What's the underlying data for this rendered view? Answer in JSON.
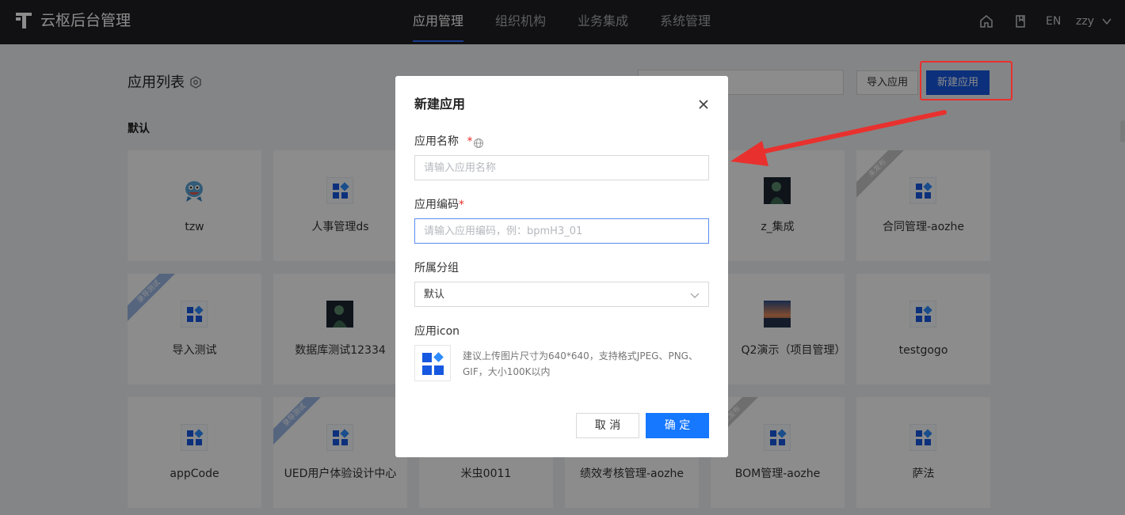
{
  "header": {
    "brand": "云枢后台管理",
    "nav": [
      "应用管理",
      "组织机构",
      "业务集成",
      "系统管理"
    ],
    "active_nav": "应用管理",
    "lang": "EN",
    "user": "zzy"
  },
  "page": {
    "title": "应用列表",
    "group": "默认",
    "import_button": "导入应用",
    "new_button": "新建应用"
  },
  "apps": [
    {
      "name": "tzw",
      "icon": "avatar-fish-icon"
    },
    {
      "name": "人事管理ds",
      "icon": "app-grid-icon"
    },
    {
      "name": "",
      "icon": ""
    },
    {
      "name": "",
      "icon": ""
    },
    {
      "name": "z_集成",
      "icon": "photo-icon"
    },
    {
      "name": "合同管理-aozhe",
      "icon": "app-grid-icon",
      "ribbon": "未发布"
    },
    {
      "name": "导入测试",
      "icon": "app-grid-icon",
      "ribbon": "录导测试"
    },
    {
      "name": "数据库测试12334",
      "icon": "photo-icon"
    },
    {
      "name": "",
      "icon": ""
    },
    {
      "name": "",
      "icon": ""
    },
    {
      "name": "Q2演示（项目管理）",
      "icon": "sunset-photo-icon"
    },
    {
      "name": "testgogo",
      "icon": "app-grid-icon"
    },
    {
      "name": "appCode",
      "icon": "app-grid-icon"
    },
    {
      "name": "UED用户体验设计中心",
      "icon": "app-grid-icon",
      "ribbon": "录导测试"
    },
    {
      "name": "米虫0011",
      "icon": ""
    },
    {
      "name": "绩效考核管理-aozhe",
      "icon": ""
    },
    {
      "name": "BOM管理-aozhe",
      "icon": "app-grid-icon",
      "ribbon": "未发布"
    },
    {
      "name": "萨法",
      "icon": "app-grid-icon"
    }
  ],
  "modal": {
    "title": "新建应用",
    "name_label": "应用名称",
    "name_placeholder": "请输入应用名称",
    "code_label": "应用编码",
    "code_placeholder": "请输入应用编码，例：bpmH3_01",
    "group_label": "所属分组",
    "group_value": "默认",
    "icon_label": "应用icon",
    "icon_hint": "建议上传图片尺寸为640*640，支持格式JPEG、PNG、GIF，大小100K以内",
    "required_mark": "*",
    "cancel": "取 消",
    "ok": "确 定"
  },
  "colors": {
    "primary": "#1677ff",
    "brand_blue": "#1658e0",
    "annotation_red": "#e8312e",
    "topbar": "#1f2023"
  }
}
